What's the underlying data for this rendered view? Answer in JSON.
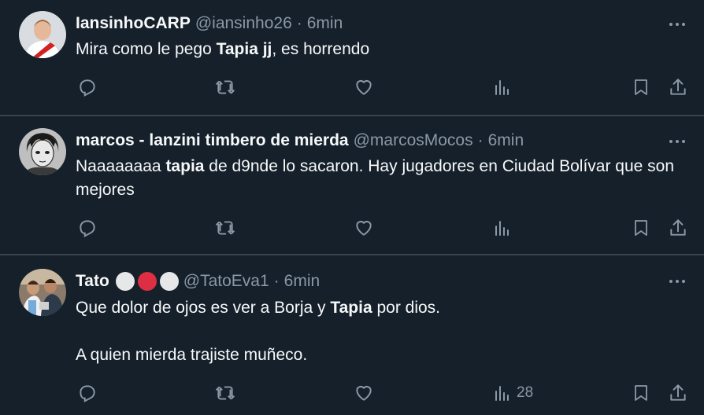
{
  "tweets": [
    {
      "name": "IansinhoCARP",
      "handle": "@iansinho26",
      "time": "6min",
      "body_parts": [
        "Mira como le pego ",
        "Tapia jj",
        ", es horrendo"
      ],
      "views": ""
    },
    {
      "name": "marcos - lanzini timbero de mierda",
      "handle": "@marcosMocos",
      "time": "6min",
      "body_parts": [
        "Naaaaaaaa ",
        "tapia",
        " de d9nde lo sacaron. Hay jugadores en Ciudad Bolívar que son mejores"
      ],
      "views": ""
    },
    {
      "name": "Tato",
      "handle": "@TatoEva1",
      "time": "6min",
      "body_line1_parts": [
        "Que dolor de ojos es ver a Borja y ",
        "Tapia",
        " por dios."
      ],
      "body_line2": "A quien mierda trajiste muñeco.",
      "views": "28",
      "name_emojis": [
        "white-circle",
        "red-circle",
        "white-circle"
      ]
    }
  ],
  "dot_separator": "·",
  "colors": {
    "background": "#15202b",
    "text": "#f7f9f9",
    "secondary": "#8b98a5",
    "divider": "#38444d",
    "red_circle": "#dd2e44",
    "white_circle": "#e6e7e8"
  },
  "icons": [
    "more-icon",
    "reply-icon",
    "retweet-icon",
    "like-icon",
    "views-icon",
    "bookmark-icon",
    "share-icon"
  ]
}
